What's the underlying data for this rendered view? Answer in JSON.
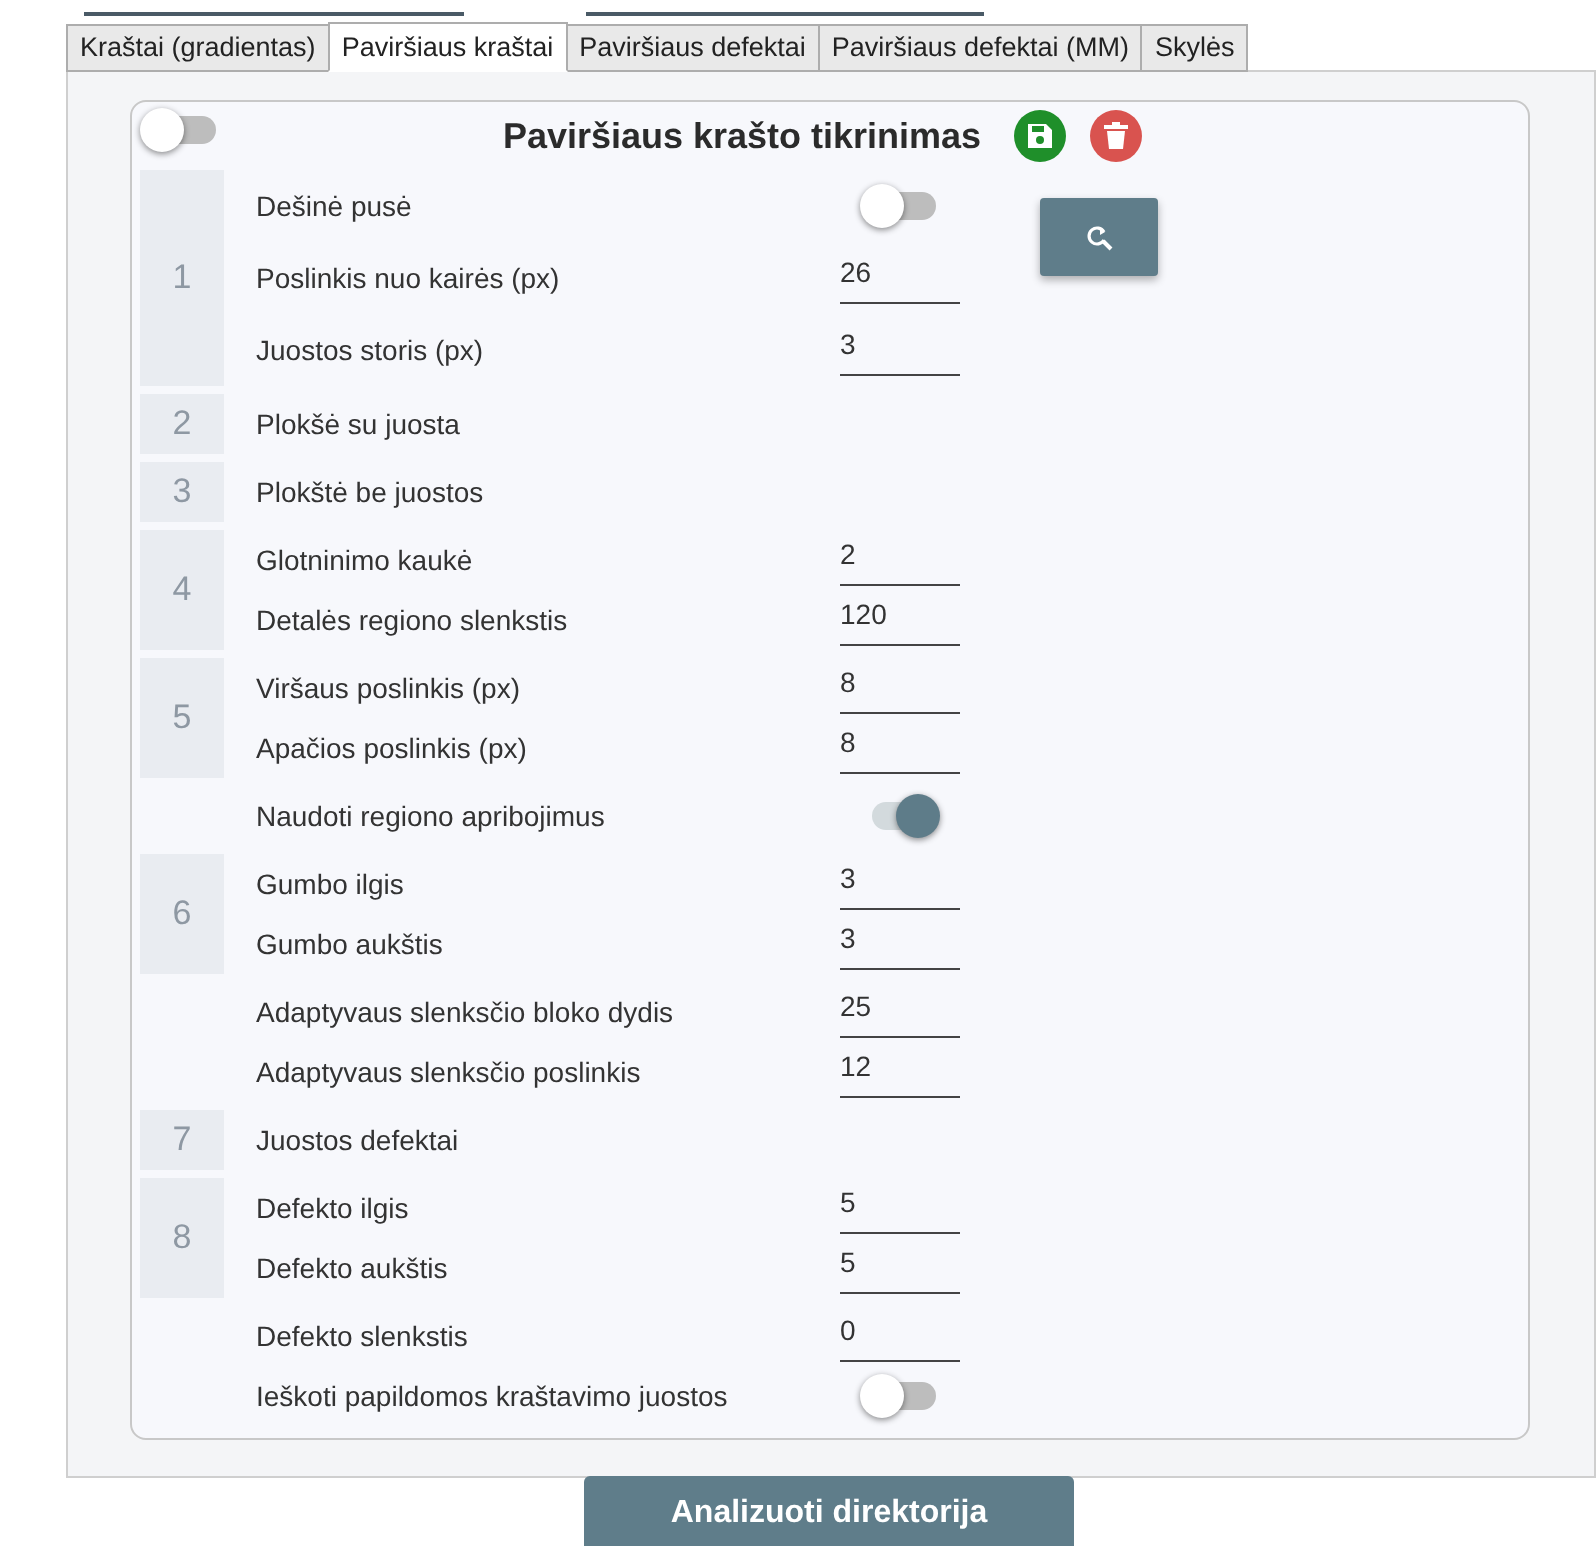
{
  "tabs": [
    {
      "label": "Kraštai (gradientas)",
      "selected": false
    },
    {
      "label": "Paviršiaus kraštai",
      "selected": true
    },
    {
      "label": "Paviršiaus defektai",
      "selected": false
    },
    {
      "label": "Paviršiaus defektai (MM)",
      "selected": false
    },
    {
      "label": "Skylės",
      "selected": false
    }
  ],
  "card": {
    "enabled": false,
    "title": "Paviršiaus krašto tikrinimas"
  },
  "groups": [
    {
      "number": "1",
      "rows": [
        {
          "kind": "toggle",
          "label": "Dešinė pusė",
          "on": false
        },
        {
          "kind": "input",
          "label": "Poslinkis nuo kairės (px)",
          "value": "26"
        },
        {
          "kind": "input",
          "label": "Juostos storis (px)",
          "value": "3"
        }
      ]
    },
    {
      "number": "2",
      "rows": [
        {
          "kind": "label",
          "label": "Plokšė su juosta"
        }
      ]
    },
    {
      "number": "3",
      "rows": [
        {
          "kind": "label",
          "label": "Plokštė be juostos"
        }
      ]
    },
    {
      "number": "4",
      "rows": [
        {
          "kind": "input",
          "label": "Glotninimo kaukė",
          "value": "2"
        },
        {
          "kind": "input",
          "label": "Detalės regiono slenkstis",
          "value": "120"
        }
      ]
    },
    {
      "number": "5",
      "rows": [
        {
          "kind": "input",
          "label": "Viršaus poslinkis (px)",
          "value": "8"
        },
        {
          "kind": "input",
          "label": "Apačios poslinkis (px)",
          "value": "8"
        }
      ]
    },
    {
      "rows": [
        {
          "kind": "toggle",
          "label": "Naudoti regiono apribojimus",
          "on": true
        }
      ]
    },
    {
      "number": "6",
      "rows": [
        {
          "kind": "input",
          "label": "Gumbo ilgis",
          "value": "3"
        },
        {
          "kind": "input",
          "label": "Gumbo aukštis",
          "value": "3"
        }
      ]
    },
    {
      "rows": [
        {
          "kind": "input",
          "label": "Adaptyvaus slenksčio bloko dydis",
          "value": "25"
        },
        {
          "kind": "input",
          "label": "Adaptyvaus slenksčio poslinkis",
          "value": "12"
        }
      ]
    },
    {
      "number": "7",
      "rows": [
        {
          "kind": "label",
          "label": "Juostos defektai"
        }
      ]
    },
    {
      "number": "8",
      "rows": [
        {
          "kind": "input",
          "label": "Defekto ilgis",
          "value": "5"
        },
        {
          "kind": "input",
          "label": "Defekto aukštis",
          "value": "5"
        }
      ]
    },
    {
      "rows": [
        {
          "kind": "input",
          "label": "Defekto slenkstis",
          "value": "0"
        },
        {
          "kind": "toggle",
          "label": "Ieškoti papildomos kraštavimo juostos",
          "on": false
        }
      ]
    }
  ],
  "analyze_button": "Analizuoti direktorija"
}
